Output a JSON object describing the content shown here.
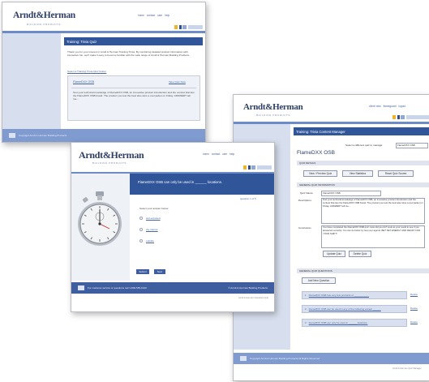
{
  "brand": {
    "logo": "Arndt&Herman",
    "tagline": "BUILDING PRODUCTS",
    "accent_colors": [
      "#f0b429",
      "#2d4f8f",
      "#8fa7d6",
      "#c9d5ea"
    ]
  },
  "top_links": [
    "home",
    "contact",
    "user",
    "help"
  ],
  "top_links_long": [
    "client view",
    "flameguard",
    "logout"
  ],
  "card1": {
    "header": "Training: Trivia Quiz",
    "intro": "Thank you for your interest in Arndt & Herman Training Trivia. By combining detailed product information with interactive fun, we'll make it easy to become familiar with the wide range of Arndt & Herman Building Products.",
    "select_link": "Select a Training Trivia Quiz below:",
    "quiz_title": "FlameDXX OSB",
    "quiz_action": "Take Quiz Now",
    "quiz_desc": "Test your technical knowledge of FlameDXX OSB, an innovative product introduction and the contest that ties the FlameDXX OSB brand. The product you test the best also wins a cool jacket on Friday. ANSWER? tell me...",
    "footer": "Copyright Arndt & Herman Building Products"
  },
  "card2": {
    "question": "FlameDXX OSB can only be used in ______ locations.",
    "counter": "question 1 of 5",
    "prompt": "Select your answer below:",
    "answers": [
      "wet-exposed",
      "dry interior",
      "outside"
    ],
    "submit": "Submit",
    "next": "Next",
    "footer_left": "For customer service or questions call 1-800-555-0100",
    "footer_right": "© Arndt & Herman Building Products",
    "credit": "Arndt & Herman Interactive Quiz"
  },
  "card3": {
    "header": "Training: Trivia Content Manager",
    "select_label": "Select a different quiz to manage:",
    "select_value": "FlameDXX OSB",
    "title": "FlameDXX OSB",
    "section_quiz": "QUIZ DETAILS",
    "btn_preview": "View / Preview Quiz",
    "btn_stats": "View Statistics",
    "btn_reset": "Reset Quiz Scores",
    "section_general": "GENERAL QUIZ INFORMATION",
    "quiz_name_label": "Quiz Name:",
    "quiz_name_value": "FlameDXX OSB",
    "description_label": "Description:",
    "description_value": "Test your technical knowledge of FlameDXX OSB, an innovative product introduction and the contest that ties the FlameDXX OSB brand. The product you test the best also wins a cool jacket on Friday. ANSWER? tell me...",
    "conclusion_label": "Conclusion:",
    "conclusion_value": "You have completed the FlameDXX OSB quiz. How did you do? Look at your result to see if you answered correctly. You can do better by test your agents. BET SET ENERGY AND READY FOR YOUR SHIFT!",
    "btn_update": "Update Quiz",
    "btn_delete": "Delete Quiz",
    "section_questions": "GENERAL QUIZ QUESTIONS",
    "btn_add_question": "Add New Question",
    "questions": [
      "FlameDXX OSB has very few products of ___________",
      "FlameDXX OSB can be used in any of the following except ______",
      "FlameDXX OSB can only be used in ______ locations."
    ],
    "delete_label": "Delete",
    "footer": "Copyright Arndt & Herman Building Products All Rights Reserved",
    "credit": "Arndt & Herman Quiz Manager"
  }
}
